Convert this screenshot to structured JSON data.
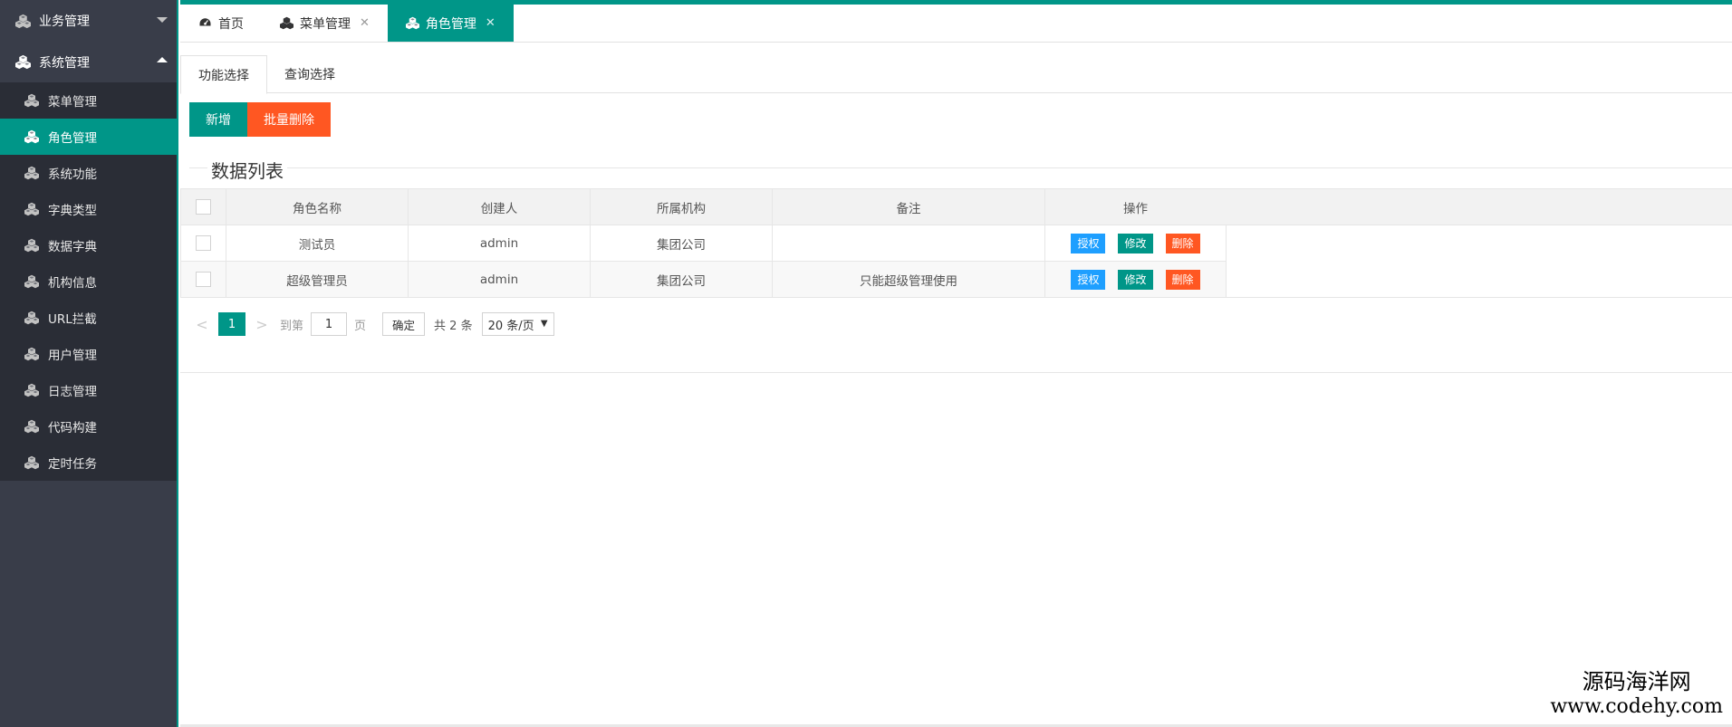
{
  "sidebar": {
    "groups": [
      {
        "label": "业务管理",
        "icon": "cubes-icon",
        "expanded": false
      },
      {
        "label": "系统管理",
        "icon": "cubes-icon",
        "expanded": true
      }
    ],
    "items": [
      {
        "label": "菜单管理",
        "active": false
      },
      {
        "label": "角色管理",
        "active": true
      },
      {
        "label": "系统功能",
        "active": false
      },
      {
        "label": "字典类型",
        "active": false
      },
      {
        "label": "数据字典",
        "active": false
      },
      {
        "label": "机构信息",
        "active": false
      },
      {
        "label": "URL拦截",
        "active": false
      },
      {
        "label": "用户管理",
        "active": false
      },
      {
        "label": "日志管理",
        "active": false
      },
      {
        "label": "代码构建",
        "active": false
      },
      {
        "label": "定时任务",
        "active": false
      }
    ]
  },
  "top_tabs": [
    {
      "label": "首页",
      "icon": "dashboard-icon",
      "closable": false,
      "active": false
    },
    {
      "label": "菜单管理",
      "icon": "cubes-icon",
      "closable": true,
      "active": false
    },
    {
      "label": "角色管理",
      "icon": "cubes-icon",
      "closable": true,
      "active": true
    }
  ],
  "sub_tabs": [
    {
      "label": "功能选择",
      "active": true
    },
    {
      "label": "查询选择",
      "active": false
    }
  ],
  "toolbar": {
    "add_label": "新增",
    "batch_delete_label": "批量删除"
  },
  "section_title": "数据列表",
  "table": {
    "columns": [
      "角色名称",
      "创建人",
      "所属机构",
      "备注",
      "操作"
    ],
    "rows": [
      {
        "name": "测试员",
        "creator": "admin",
        "org": "集团公司",
        "remark": ""
      },
      {
        "name": "超级管理员",
        "creator": "admin",
        "org": "集团公司",
        "remark": "只能超级管理使用"
      }
    ],
    "actions": {
      "authorize": "授权",
      "edit": "修改",
      "delete": "删除"
    }
  },
  "pager": {
    "prev": "<",
    "current": "1",
    "next": ">",
    "goto_prefix": "到第",
    "goto_value": "1",
    "goto_suffix": "页",
    "confirm": "确定",
    "total": "共 2 条",
    "page_size": "20 条/页"
  },
  "watermark": {
    "line1": "源码海洋网",
    "line2": "www.codehy.com"
  },
  "colors": {
    "accent": "#009688",
    "danger": "#ff5722",
    "info": "#1e9fff",
    "sidebar_bg": "#393d49"
  }
}
